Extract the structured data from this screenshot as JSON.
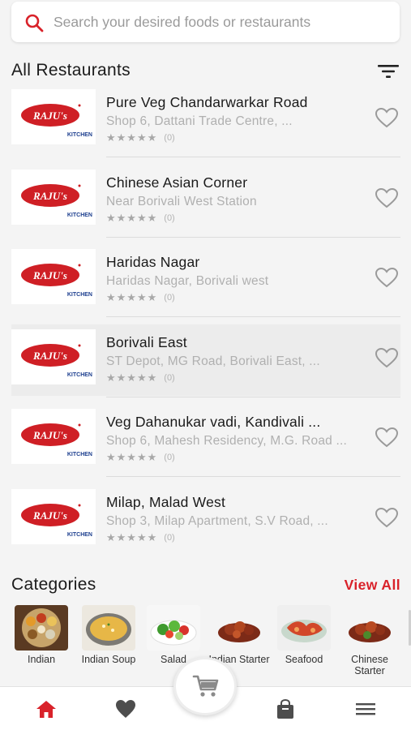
{
  "search": {
    "placeholder": "Search your desired foods or restaurants",
    "value": ""
  },
  "restaurants_section": {
    "title": "All Restaurants"
  },
  "restaurants": [
    {
      "name": "Pure Veg Chandarwarkar Road",
      "address": "Shop 6, Dattani Trade Centre, ...",
      "stars": "★★★★★",
      "rating_count": "(0)"
    },
    {
      "name": "Chinese Asian Corner",
      "address": "Near Borivali West Station",
      "stars": "★★★★★",
      "rating_count": "(0)"
    },
    {
      "name": "Haridas Nagar",
      "address": "Haridas Nagar, Borivali west",
      "stars": "★★★★★",
      "rating_count": "(0)"
    },
    {
      "name": "Borivali East",
      "address": "ST Depot, MG Road, Borivali East, ...",
      "stars": "★★★★★",
      "rating_count": "(0)"
    },
    {
      "name": "Veg Dahanukar vadi, Kandivali ...",
      "address": "Shop 6, Mahesh Residency, M.G. Road ...",
      "stars": "★★★★★",
      "rating_count": "(0)"
    },
    {
      "name": "Milap, Malad West",
      "address": "Shop 3, Milap Apartment, S.V Road, ...",
      "stars": "★★★★★",
      "rating_count": "(0)"
    }
  ],
  "logo": {
    "line1": "RAJU's",
    "line2": "KITCHEN"
  },
  "categories_section": {
    "title": "Categories",
    "view_all": "View All"
  },
  "categories": [
    {
      "label": "Indian"
    },
    {
      "label": "Indian Soup"
    },
    {
      "label": "Salad"
    },
    {
      "label": "Indian Starter"
    },
    {
      "label": "Seafood"
    },
    {
      "label": "Chinese Starter"
    }
  ],
  "nav": [
    "home-icon",
    "heart-icon",
    "cart-icon",
    "bag-icon",
    "menu-icon"
  ],
  "colors": {
    "accent": "#d9222a",
    "brand_logo_red": "#cf1f25",
    "brand_logo_blue": "#1d3f8f"
  }
}
